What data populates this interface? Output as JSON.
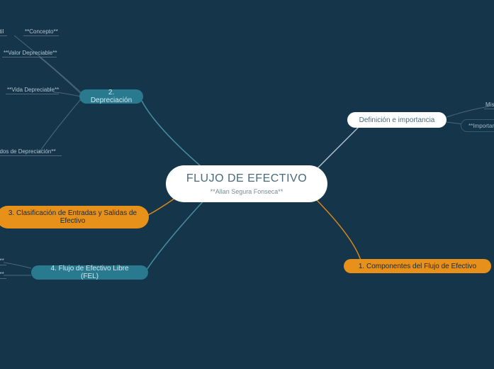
{
  "center": {
    "title": "FLUJO DE EFECTIVO",
    "subtitle": "**Allan Segura Fonseca**"
  },
  "nodes": {
    "depreciacion": "2. Depreciación",
    "clasificacion": "3. Clasificación de Entradas y Salidas de Efectivo",
    "fel": "4. Flujo de Efectivo Libre (FEL)",
    "definicion": "Definición e importancia",
    "componentes": "1. Componentes del Flujo de Efectivo"
  },
  "leaves": {
    "util": "útil",
    "concepto": "**Concepto**",
    "valor_depreciable": "**Valor Depreciable**",
    "vida_depreciable": "**Vida Depreciable**",
    "metodos_depreciacion": "odos de Depreciación**",
    "fel_n": "n**",
    "fel_a": "a**",
    "mis": "Mis",
    "importancia": "**Importan"
  }
}
